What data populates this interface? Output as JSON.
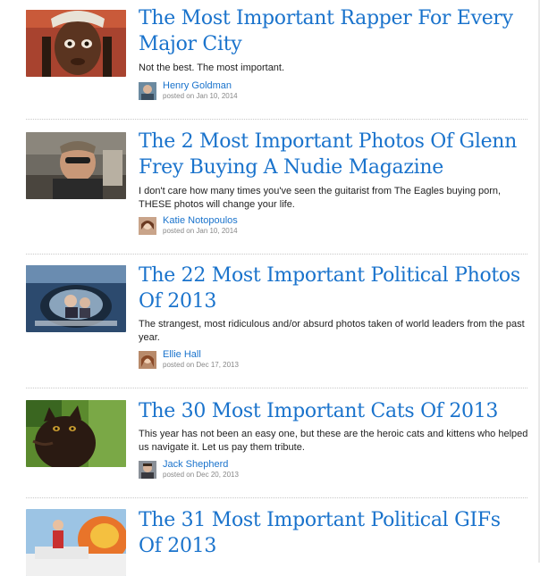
{
  "articles": [
    {
      "title": "The Most Important Rapper For Every Major City",
      "description": "Not the best. The most important.",
      "author": "Henry Goldman",
      "posted": "posted on Jan 10, 2014"
    },
    {
      "title": "The 2 Most Important Photos Of Glenn Frey Buying A Nudie Magazine",
      "description": "I don't care how many times you've seen the guitarist from The Eagles buying porn, THESE photos will change your life.",
      "author": "Katie Notopoulos",
      "posted": "posted on Jan 10, 2014"
    },
    {
      "title": "The 22 Most Important Political Photos Of 2013",
      "description": "The strangest, most ridiculous and/or absurd photos taken of world leaders from the past year.",
      "author": "Ellie Hall",
      "posted": "posted on Dec 17, 2013"
    },
    {
      "title": "The 30 Most Important Cats Of 2013",
      "description": "This year has not been an easy one, but these are the heroic cats and kittens who helped us navigate it. Let us pay them tribute.",
      "author": "Jack Shepherd",
      "posted": "posted on Dec 20, 2013"
    },
    {
      "title": "The 31 Most Important Political GIFs Of 2013"
    }
  ]
}
